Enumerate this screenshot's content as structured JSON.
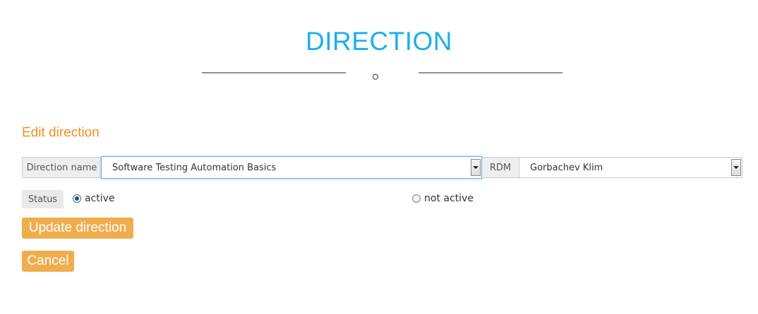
{
  "header": {
    "title": "DIRECTION"
  },
  "form": {
    "heading": "Edit direction",
    "direction_name_label": "Direction name",
    "direction_name_value": "Software Testing Automation Basics",
    "rdm_label": "RDM",
    "rdm_value": "Gorbachev Klim",
    "status_label": "Status",
    "status_options": [
      {
        "label": "active",
        "checked": true
      },
      {
        "label": "not active",
        "checked": false
      }
    ],
    "update_button": "Update direction",
    "cancel_button": "Cancel"
  },
  "colors": {
    "title": "#1ab0ec",
    "heading": "#f0901e",
    "button": "#f0ad4e"
  },
  "icons": {
    "dropdown": "chevron-down-icon",
    "divider_ornament": "circle-icon"
  }
}
